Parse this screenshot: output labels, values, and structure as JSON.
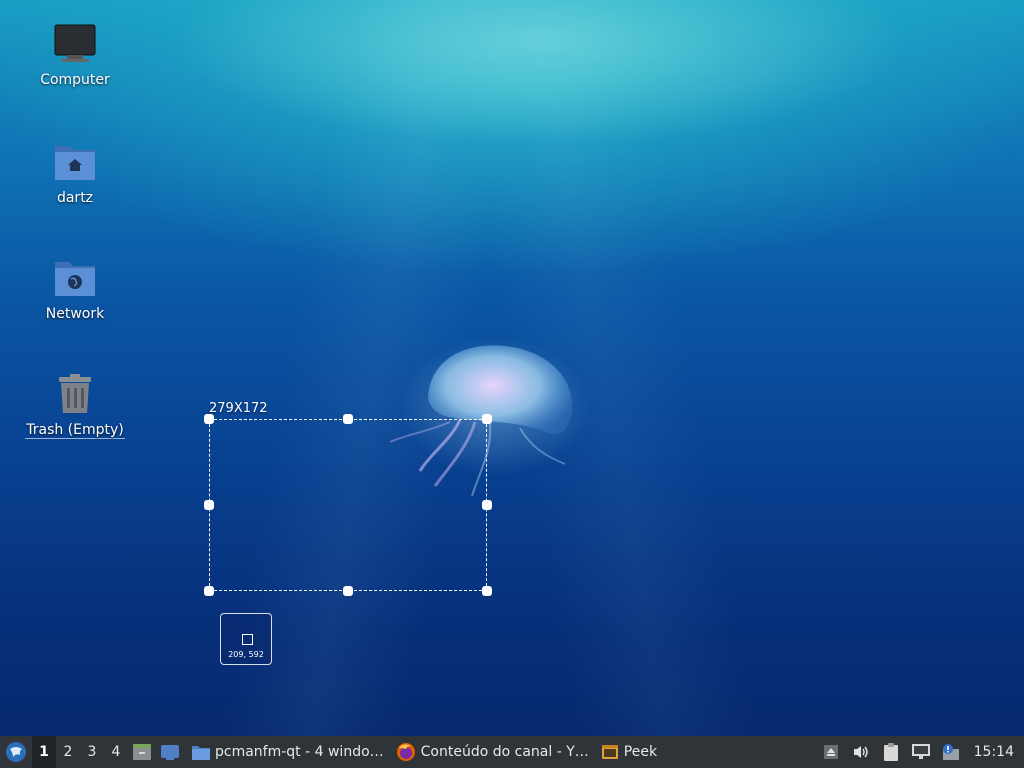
{
  "desktop": {
    "icons": [
      {
        "label": "Computer",
        "icon": "computer-icon"
      },
      {
        "label": "dartz",
        "icon": "home-folder-icon"
      },
      {
        "label": "Network",
        "icon": "network-folder-icon"
      },
      {
        "label": "Trash (Empty)",
        "icon": "trash-icon"
      }
    ]
  },
  "selection": {
    "size_label": "279X172",
    "cursor_coords": "209, 592"
  },
  "taskbar": {
    "menu_icon": "lxqt-menu-icon",
    "workspaces": [
      "1",
      "2",
      "3",
      "4"
    ],
    "active_workspace": "1",
    "quicklaunch": [
      "file-manager-icon",
      "show-desktop-icon"
    ],
    "tasks": [
      {
        "label": "pcmanfm-qt - 4 windo…",
        "icon": "folder-icon"
      },
      {
        "label": "Conteúdo do canal - Y…",
        "icon": "firefox-icon"
      },
      {
        "label": "Peek",
        "icon": "peek-icon"
      }
    ],
    "tray": [
      "eject-icon",
      "volume-icon",
      "clipboard-icon",
      "network-icon",
      "update-notifier-icon"
    ],
    "clock": "15:14"
  },
  "colors": {
    "taskbar_bg": "#2f3439",
    "folder_blue": "#4f7fc4",
    "water_top": "#1a9fc4",
    "water_bottom": "#06266a"
  }
}
